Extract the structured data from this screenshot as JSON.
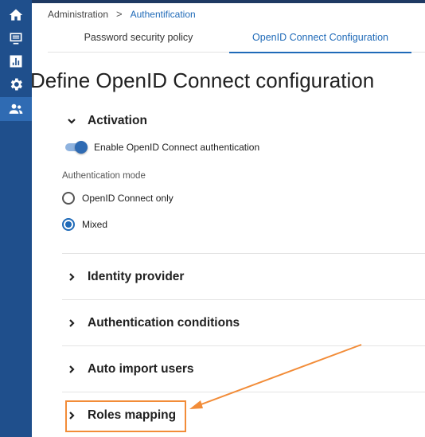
{
  "breadcrumb": {
    "root": "Administration",
    "separator": ">",
    "current": "Authentification"
  },
  "tabs": [
    {
      "label": "Password security policy",
      "active": false
    },
    {
      "label": "OpenID Connect Configuration",
      "active": true
    }
  ],
  "page_title": "Define OpenID Connect configuration",
  "sections": {
    "activation": {
      "title": "Activation",
      "expanded": true
    },
    "identity_provider": {
      "title": "Identity provider",
      "expanded": false
    },
    "authentication_conditions": {
      "title": "Authentication conditions",
      "expanded": false
    },
    "auto_import_users": {
      "title": "Auto import users",
      "expanded": false
    },
    "roles_mapping": {
      "title": "Roles mapping",
      "expanded": false
    }
  },
  "activation": {
    "toggle_label": "Enable OpenID Connect authentication",
    "toggle_on": true,
    "auth_mode_label": "Authentication mode",
    "options": [
      {
        "label": "OpenID Connect only",
        "selected": false
      },
      {
        "label": "Mixed",
        "selected": true
      }
    ]
  },
  "sidebar": {
    "items": [
      {
        "icon": "home-icon",
        "active": false
      },
      {
        "icon": "monitor-list-icon",
        "active": false
      },
      {
        "icon": "bar-chart-icon",
        "active": false
      },
      {
        "icon": "gear-icon",
        "active": false
      },
      {
        "icon": "users-icon",
        "active": true
      }
    ]
  },
  "colors": {
    "sidebar": "#1f4f8c",
    "sidebar_active": "#2f6bb3",
    "accent": "#1f6ab8",
    "annotation": "#f28c38"
  }
}
